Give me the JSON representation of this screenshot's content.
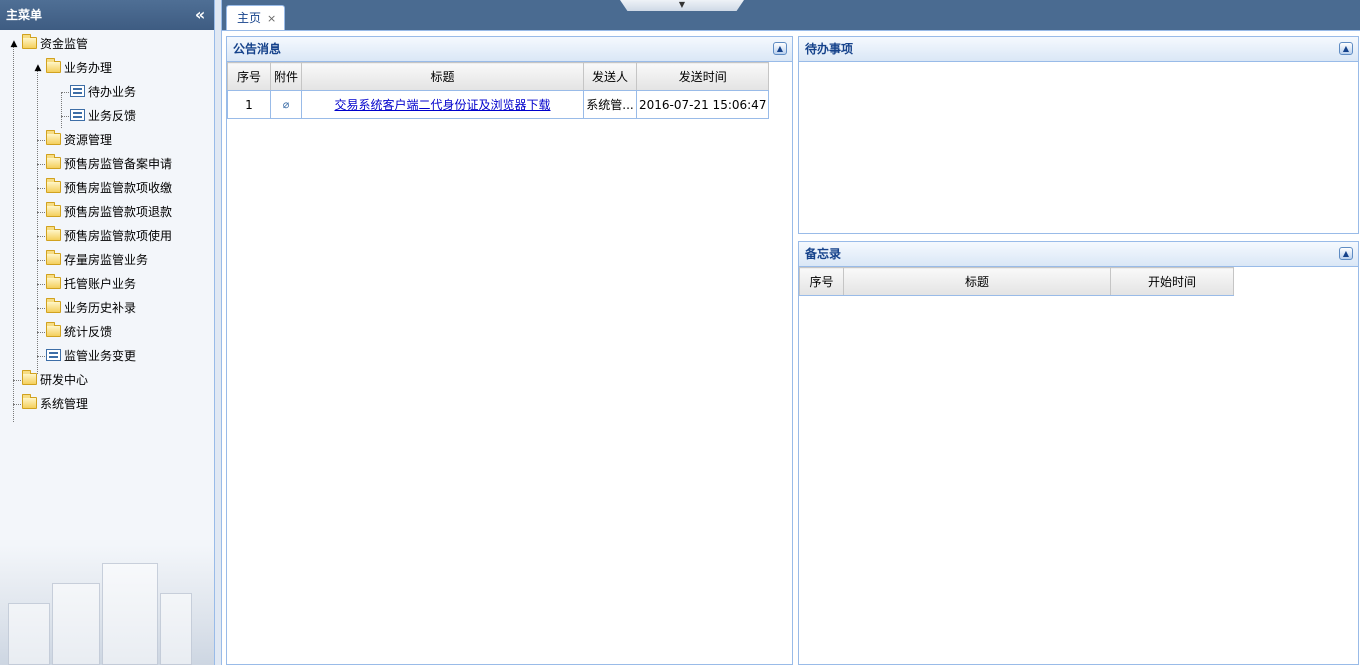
{
  "sidebar": {
    "title": "主菜单",
    "collapse_glyph": "«",
    "tree": {
      "root1": "资金监管",
      "biz": "业务办理",
      "todo": "待办业务",
      "feedback": "业务反馈",
      "resource": "资源管理",
      "presale_record": "预售房监管备案申请",
      "presale_collect": "预售房监管款项收缴",
      "presale_refund": "预售房监管款项退款",
      "presale_use": "预售房监管款项使用",
      "stock": "存量房监管业务",
      "escrow": "托管账户业务",
      "history": "业务历史补录",
      "stats": "统计反馈",
      "change": "监管业务变更",
      "rnd": "研发中心",
      "sysmgmt": "系统管理"
    }
  },
  "tabs": [
    {
      "label": "主页",
      "close": "×"
    }
  ],
  "announcements": {
    "title": "公告消息",
    "columns": {
      "index": "序号",
      "attach": "附件",
      "subject": "标题",
      "sender": "发送人",
      "time": "发送时间"
    },
    "rows": [
      {
        "index": "1",
        "subject": "交易系统客户端二代身份证及浏览器下载",
        "sender": "系统管...",
        "time": "2016-07-21 15:06:47"
      }
    ]
  },
  "todo": {
    "title": "待办事项"
  },
  "memo": {
    "title": "备忘录",
    "columns": {
      "index": "序号",
      "subject": "标题",
      "start": "开始时间"
    }
  },
  "icons": {
    "folder": "folder-icon",
    "leaf": "document-icon",
    "attachment": "paperclip-icon",
    "collapse_panel": "chevron-up-icon",
    "pull_tab": "chevron-down-icon"
  },
  "colors": {
    "header": "#4a6b91",
    "panel_border": "#99bbe8",
    "panel_title": "#15428b",
    "link": "#0000cc"
  }
}
